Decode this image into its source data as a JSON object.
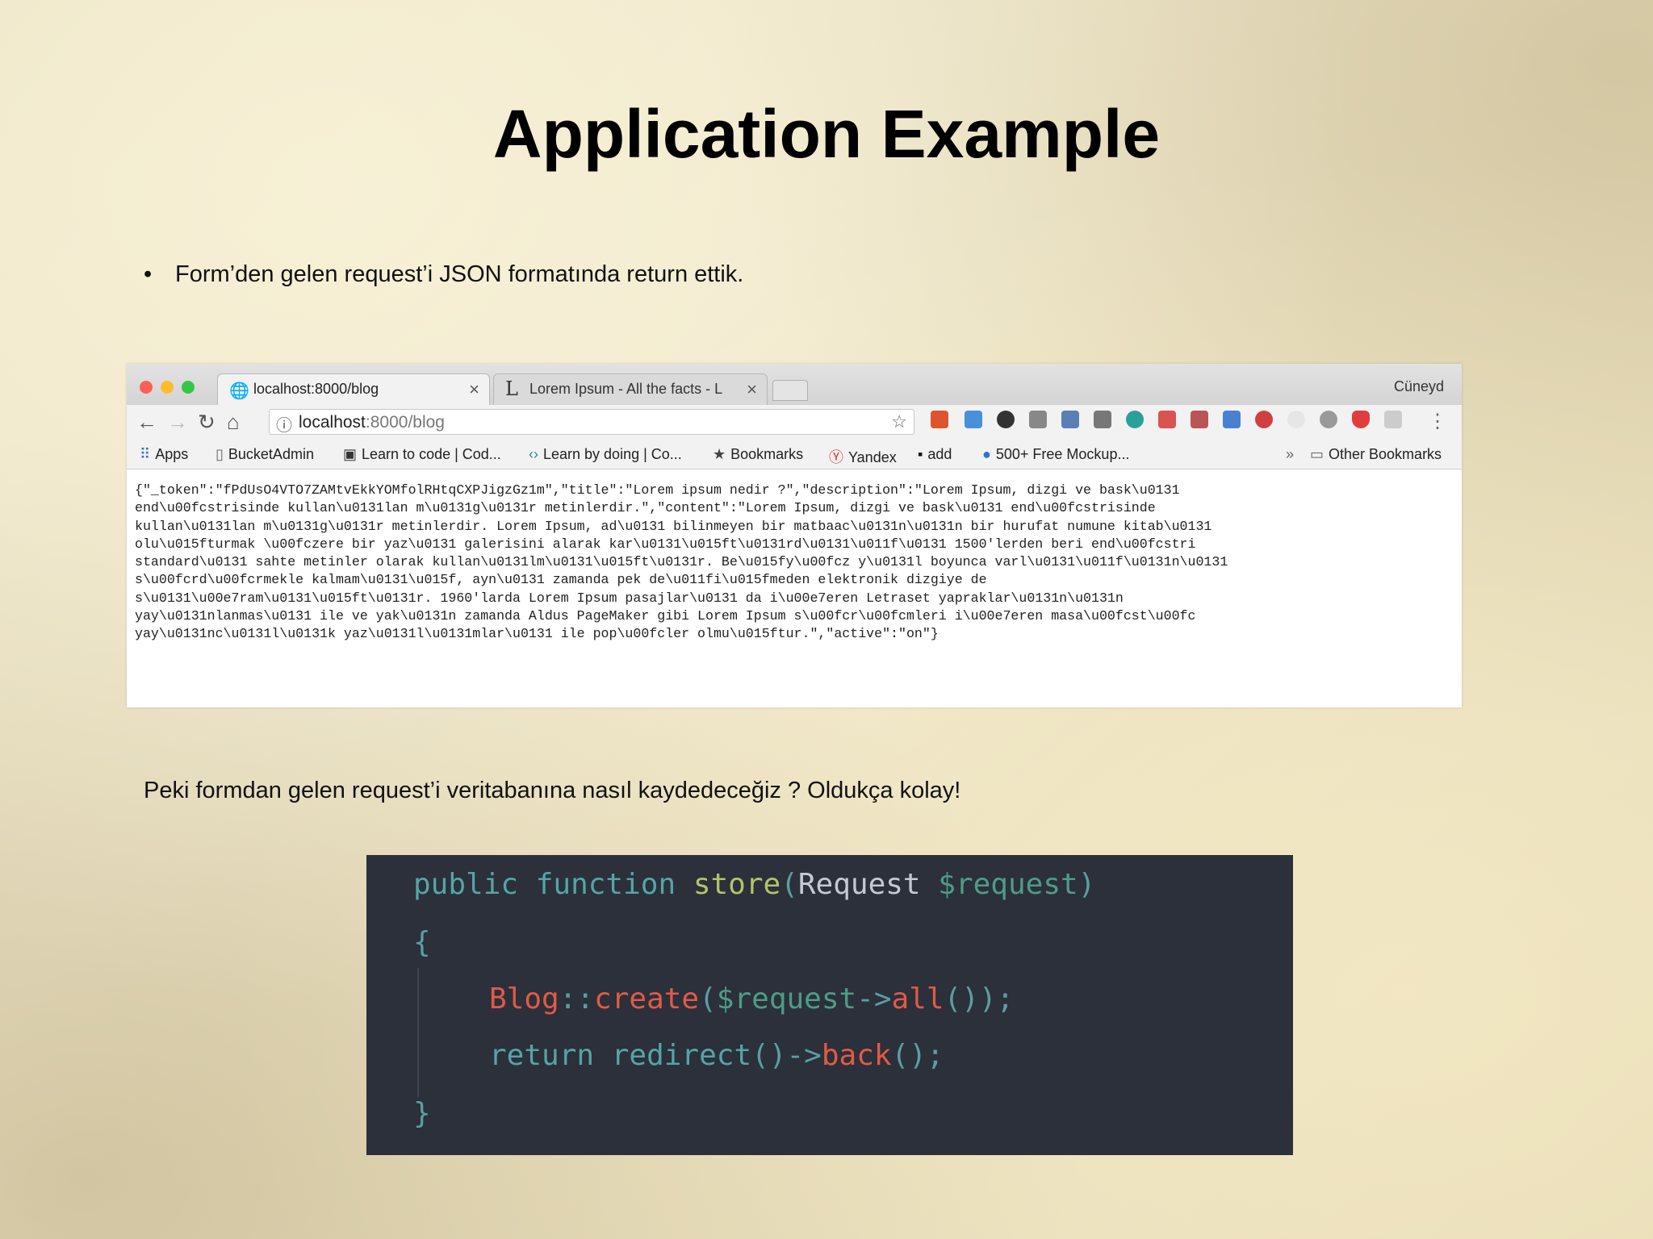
{
  "slide": {
    "title": "Application Example",
    "bullet_symbol": "•",
    "bullet_text": "Form’den gelen request’i JSON formatında return ettik.",
    "question": "Peki formdan gelen request’i veritabanına nasıl kaydedeceğiz ? Oldukça kolay!"
  },
  "browser": {
    "tabs": [
      {
        "label": "localhost:8000/blog",
        "close": "×",
        "icon": "globe-icon"
      },
      {
        "label": "Lorem Ipsum - All the facts - L",
        "close": "×",
        "icon": "lipsum-L-icon",
        "icon_glyph": "L"
      }
    ],
    "user": "Cüneyd",
    "address": {
      "host": "localhost",
      "rest": ":8000/blog"
    },
    "bookmarks": [
      {
        "label": "Apps",
        "icon": "apps-grid-icon"
      },
      {
        "label": "BucketAdmin",
        "icon": "page-icon"
      },
      {
        "label": "Learn to code | Cod...",
        "icon": "codecademy-icon"
      },
      {
        "label": "Learn by doing | Co...",
        "icon": "code-brackets-icon"
      },
      {
        "label": "Bookmarks",
        "icon": "star-icon"
      },
      {
        "label": "Yandex",
        "icon": "yandex-icon"
      },
      {
        "label": "add",
        "icon": "add-bookmark-icon"
      },
      {
        "label": "500+ Free Mockup...",
        "icon": "mockup-c-icon"
      }
    ],
    "overflow": "»",
    "other_bookmarks": "Other Bookmarks",
    "json_lines": [
      "{\"_token\":\"fPdUsO4VTO7ZAMtvEkkYOMfolRHtqCXPJigzGz1m\",\"title\":\"Lorem ipsum nedir ?\",\"description\":\"Lorem Ipsum, dizgi ve bask\\u0131",
      "end\\u00fcstrisinde kullan\\u0131lan m\\u0131g\\u0131r metinlerdir.\",\"content\":\"Lorem Ipsum, dizgi ve bask\\u0131 end\\u00fcstrisinde",
      "kullan\\u0131lan m\\u0131g\\u0131r metinlerdir. Lorem Ipsum, ad\\u0131 bilinmeyen bir matbaac\\u0131n\\u0131n bir hurufat numune kitab\\u0131",
      "olu\\u015fturmak \\u00fczere bir yaz\\u0131 galerisini alarak kar\\u0131\\u015ft\\u0131rd\\u0131\\u011f\\u0131 1500'lerden beri end\\u00fcstri",
      "standard\\u0131 sahte metinler olarak kullan\\u0131lm\\u0131\\u015ft\\u0131r. Be\\u015fy\\u00fcz y\\u0131l boyunca varl\\u0131\\u011f\\u0131n\\u0131",
      "s\\u00fcrd\\u00fcrmekle kalmam\\u0131\\u015f, ayn\\u0131 zamanda pek de\\u011fi\\u015fmeden elektronik dizgiye de",
      "s\\u0131\\u00e7ram\\u0131\\u015ft\\u0131r. 1960'larda Lorem Ipsum pasajlar\\u0131 da i\\u00e7eren Letraset yapraklar\\u0131n\\u0131n",
      "yay\\u0131nlanmas\\u0131 ile ve yak\\u0131n zamanda Aldus PageMaker gibi Lorem Ipsum s\\u00fcr\\u00fcmleri i\\u00e7eren masa\\u00fcst\\u00fc",
      "yay\\u0131nc\\u0131l\\u0131k yaz\\u0131l\\u0131mlar\\u0131 ile pop\\u00fcler olmu\\u015ftur.\",\"active\":\"on\"}"
    ]
  },
  "code": {
    "l1": {
      "public": "public",
      "function": "function",
      "name": "store",
      "open": "(",
      "type": "Request",
      "param": "$request",
      "close": ")"
    },
    "l2": "{",
    "l3": {
      "cls": "Blog",
      "sep": "::",
      "method": "create",
      "open": "(",
      "var": "$request",
      "arrow": "->",
      "call": "all",
      "parens": "()",
      "end": ");"
    },
    "l4": {
      "kw": "return",
      "fn": "redirect",
      "parens": "()",
      "arrow": "->",
      "call": "back",
      "end": "();"
    },
    "l5": "}"
  },
  "colors": {
    "code_bg": "#2b303b",
    "keyword": "#56a4a5",
    "function_name": "#b3c36a",
    "variable": "#4e9c86",
    "method": "#e25a45"
  }
}
